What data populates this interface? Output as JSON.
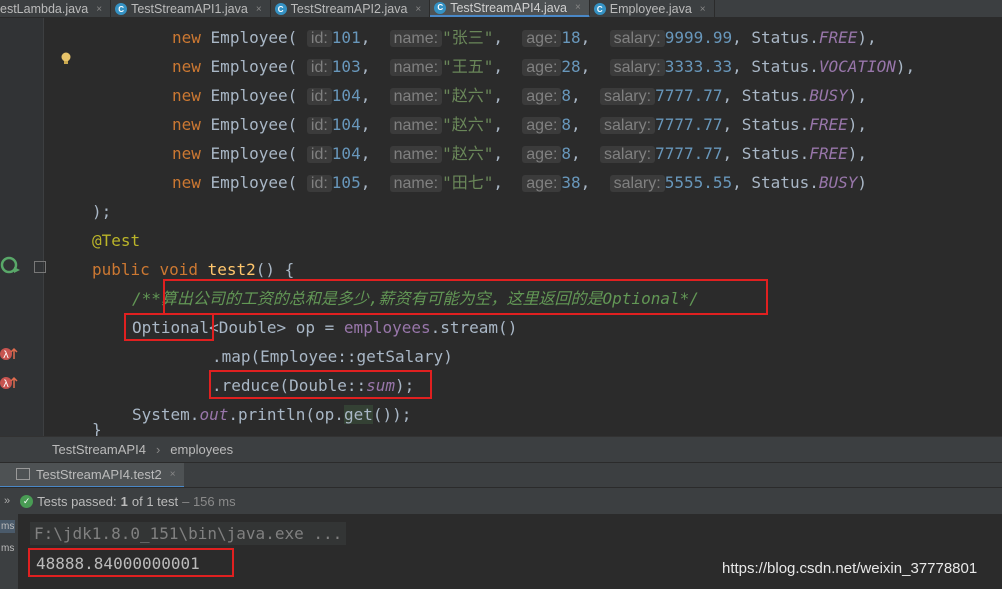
{
  "tabs": [
    {
      "label": "estLambda.java",
      "active": false,
      "has_icon": false
    },
    {
      "label": "TestStreamAPI1.java",
      "active": false,
      "has_icon": true
    },
    {
      "label": "TestStreamAPI2.java",
      "active": false,
      "has_icon": true
    },
    {
      "label": "TestStreamAPI4.java",
      "active": true,
      "has_icon": true
    },
    {
      "label": "Employee.java",
      "active": false,
      "has_icon": true
    }
  ],
  "tab_close": "×",
  "tab_icon_letter": "C",
  "code": {
    "kw_new": "new",
    "cls": "Employee(",
    "hint_id": "id:",
    "hint_name": "name:",
    "hint_age": "age:",
    "hint_salary": "salary:",
    "status_prefix": "Status.",
    "rows": [
      {
        "id": "101",
        "name": "\"张三\"",
        "age": "18",
        "salary": "9999.99",
        "status": "FREE",
        "tail": "),"
      },
      {
        "id": "103",
        "name": "\"王五\"",
        "age": "28",
        "salary": "3333.33",
        "status": "VOCATION",
        "tail": "),"
      },
      {
        "id": "104",
        "name": "\"赵六\"",
        "age": "8",
        "salary": "7777.77",
        "status": "BUSY",
        "tail": "),"
      },
      {
        "id": "104",
        "name": "\"赵六\"",
        "age": "8",
        "salary": "7777.77",
        "status": "FREE",
        "tail": "),"
      },
      {
        "id": "104",
        "name": "\"赵六\"",
        "age": "8",
        "salary": "7777.77",
        "status": "FREE",
        "tail": "),"
      },
      {
        "id": "105",
        "name": "\"田七\"",
        "age": "38",
        "salary": "5555.55",
        "status": "BUSY",
        "tail": ")"
      }
    ],
    "close_paren": ");",
    "annotation": "@Test",
    "kw_public": "public",
    "kw_void": "void",
    "method_name": "test2",
    "method_sig": "() {",
    "comment": "/**算出公司的工资的总和是多少,薪资有可能为空，这里返回的是Optional*/",
    "optional": "Optional",
    "generic": "<Double>",
    "op_assign": " op = ",
    "employees": "employees",
    "stream": ".stream()",
    "map_line": ".map(Employee::getSalary)",
    "reduce_pre": ".reduce(Double::",
    "reduce_sum": "sum",
    "reduce_post": ");",
    "sys_pre": "System.",
    "sys_out": "out",
    "sys_mid": ".println(op.",
    "sys_get": "get",
    "sys_post": "());",
    "closing_brace": "}"
  },
  "breadcrumb": {
    "class": "TestStreamAPI4",
    "member": "employees",
    "sep": "›"
  },
  "run": {
    "tab_label": "TestStreamAPI4.test2",
    "tab_close": "×",
    "chevrons": "»",
    "passed_label": "Tests passed:",
    "passed_count": "1",
    "passed_rest": "of 1 test",
    "duration": "– 156 ms",
    "gutter_ms1": "ms",
    "gutter_ms2": "ms"
  },
  "console": {
    "command": "F:\\jdk1.8.0_151\\bin\\java.exe ...",
    "output": "48888.84000000001"
  },
  "watermark": "https://blog.csdn.net/weixin_37778801",
  "colors": {
    "highlight_box": "#e02020",
    "accent": "#4a88c7",
    "pass": "#499c54"
  }
}
